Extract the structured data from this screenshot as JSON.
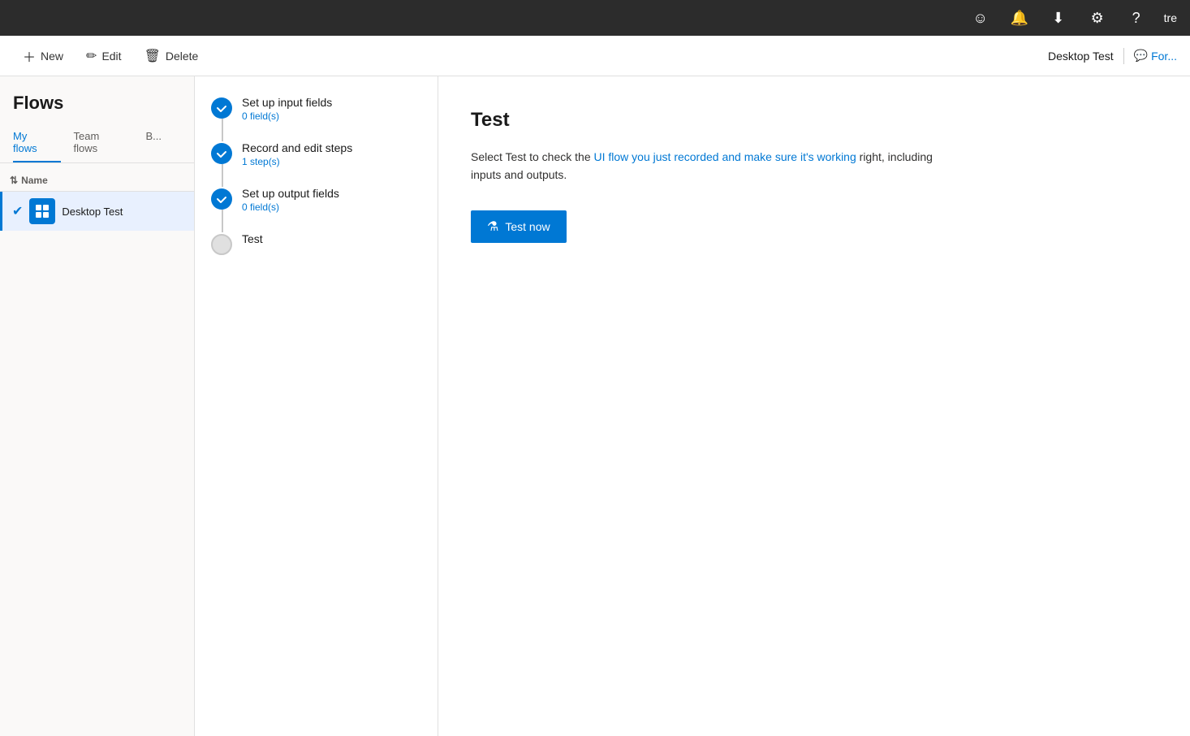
{
  "topbar": {
    "icons": [
      "smiley-icon",
      "bell-icon",
      "download-icon",
      "settings-icon",
      "help-icon"
    ],
    "user_text": "tre"
  },
  "toolbar": {
    "new_label": "New",
    "edit_label": "Edit",
    "delete_label": "Delete"
  },
  "sidebar": {
    "title": "Flows",
    "nav_items": [
      {
        "label": "My flows",
        "active": true
      },
      {
        "label": "Team flows",
        "active": false
      },
      {
        "label": "B...",
        "active": false
      }
    ],
    "table_header": "Name",
    "flow_item": {
      "name": "Desktop Test"
    }
  },
  "wizard": {
    "steps": [
      {
        "title": "Set up input fields",
        "subtitle": "0 field(s)",
        "status": "completed"
      },
      {
        "title": "Record and edit steps",
        "subtitle": "1 step(s)",
        "status": "completed"
      },
      {
        "title": "Set up output fields",
        "subtitle": "0 field(s)",
        "status": "completed"
      },
      {
        "title": "Test",
        "subtitle": "",
        "status": "pending"
      }
    ]
  },
  "main_content": {
    "title": "Test",
    "description_prefix": "Select Test to check the ",
    "description_link": "UI flow you just recorded and make sure it's working",
    "description_suffix": " right, including inputs and outputs.",
    "test_button_label": "Test now"
  },
  "right_header": {
    "title": "Desktop Test",
    "action_label": "For..."
  }
}
